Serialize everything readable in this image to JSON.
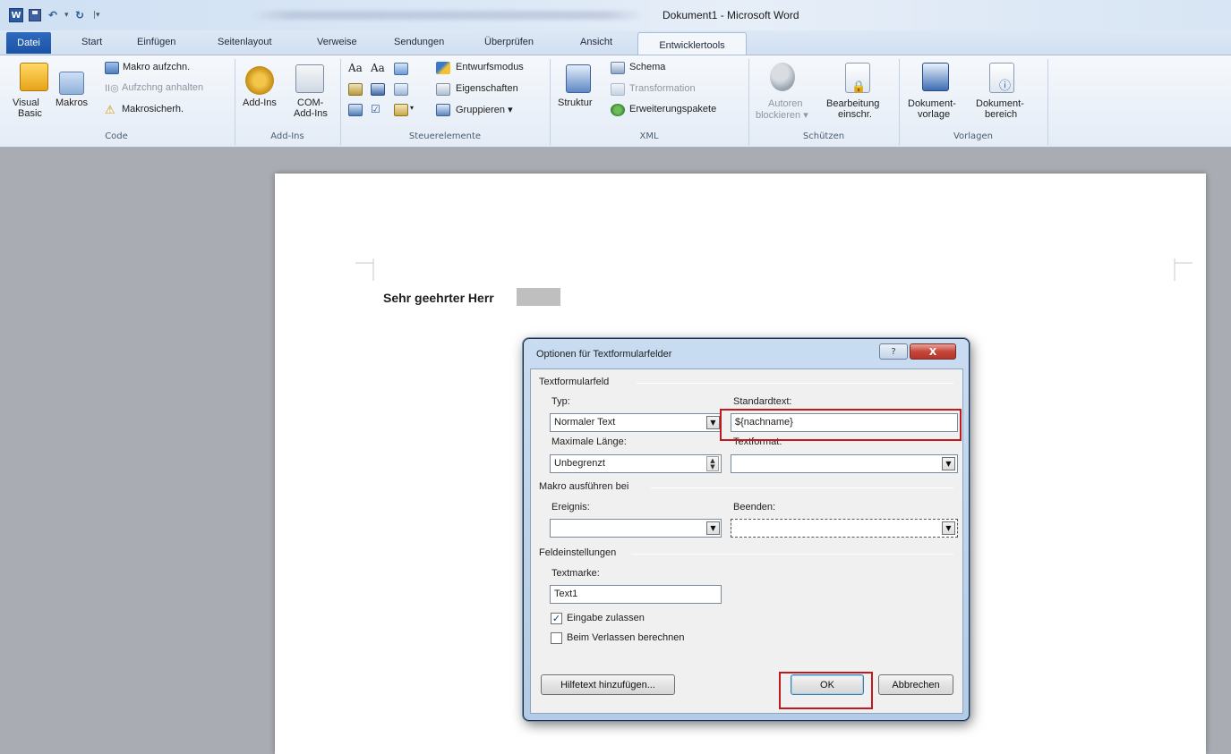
{
  "window": {
    "title": "Dokument1 - Microsoft Word",
    "word_icon_letter": "W"
  },
  "qat": {
    "icons": [
      "word-icon",
      "save-icon",
      "undo-icon",
      "redo-icon",
      "customize-icon"
    ]
  },
  "tabs": [
    {
      "label": "Datei"
    },
    {
      "label": "Start"
    },
    {
      "label": "Einfügen"
    },
    {
      "label": "Seitenlayout"
    },
    {
      "label": "Verweise"
    },
    {
      "label": "Sendungen"
    },
    {
      "label": "Überprüfen"
    },
    {
      "label": "Ansicht"
    },
    {
      "label": "Entwicklertools"
    }
  ],
  "ribbon": {
    "code": {
      "label": "Code",
      "visual_basic": [
        "Visual",
        "Basic"
      ],
      "makros": "Makros",
      "makro_aufzeichnen": "Makro aufzchn.",
      "aufzeichnung_anhalten": "Aufzchng anhalten",
      "makrosicherheit": "Makrosicherh."
    },
    "addins": {
      "label": "Add-Ins",
      "addins": "Add-Ins",
      "com_addins": [
        "COM-",
        "Add-Ins"
      ]
    },
    "steuerelemente": {
      "label": "Steuerelemente",
      "entwurfsmodus": "Entwurfsmodus",
      "eigenschaften": "Eigenschaften",
      "gruppieren": "Gruppieren ▾",
      "aa1": "Aa",
      "aa2": "Aa"
    },
    "xml": {
      "label": "XML",
      "struktur": "Struktur",
      "schema": "Schema",
      "transformation": "Transformation",
      "erweiterungspakete": "Erweiterungspakete"
    },
    "schuetzen": {
      "label": "Schützen",
      "autoren_blockieren": [
        "Autoren",
        "blockieren ▾"
      ],
      "bearbeitung_einschr": [
        "Bearbeitung",
        "einschr."
      ]
    },
    "vorlagen": {
      "label": "Vorlagen",
      "dokumentvorlage": [
        "Dokument-",
        "vorlage"
      ],
      "dokumentbereich": [
        "Dokument-",
        "bereich"
      ]
    }
  },
  "document": {
    "salutation": "Sehr geehrter Herr"
  },
  "dialog": {
    "title": "Optionen für Textformularfelder",
    "help_glyph": "?",
    "close_glyph": "X",
    "section_textformularfeld": "Textformularfeld",
    "typ_label": "Typ:",
    "typ_value": "Normaler Text",
    "standardtext_label": "Standardtext:",
    "standardtext_value": "${nachname}",
    "maxlaenge_label": "Maximale Länge:",
    "maxlaenge_value": "Unbegrenzt",
    "textformat_label": "Textformat:",
    "textformat_value": "",
    "section_makro": "Makro ausführen bei",
    "ereignis_label": "Ereignis:",
    "ereignis_value": "",
    "beenden_label": "Beenden:",
    "beenden_value": "",
    "section_feld": "Feldeinstellungen",
    "textmarke_label": "Textmarke:",
    "textmarke_value": "Text1",
    "eingabe_label": "Eingabe zulassen",
    "eingabe_checked": true,
    "verlassen_label": "Beim Verlassen berechnen",
    "verlassen_checked": false,
    "hilfetext_button": "Hilfetext hinzufügen...",
    "ok_button": "OK",
    "abbrechen_button": "Abbrechen"
  },
  "highlight_color": "#c0191e"
}
